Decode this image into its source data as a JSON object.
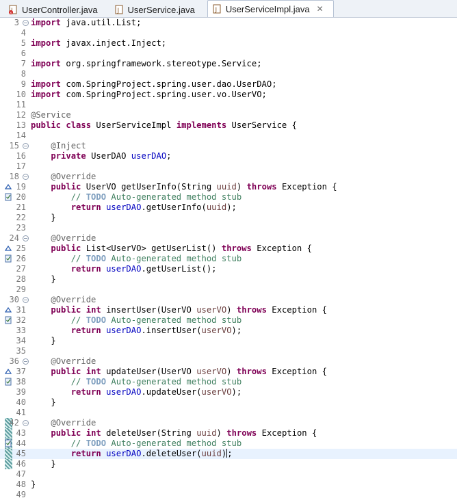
{
  "tabs": [
    {
      "label": "UserController.java",
      "active": false
    },
    {
      "label": "UserService.java",
      "active": false
    },
    {
      "label": "UserServiceImpl.java",
      "active": true
    }
  ],
  "colors": {
    "keyword": "#7f0055",
    "annotation": "#646464",
    "field": "#0000c0",
    "parameter": "#6a3e3e",
    "comment": "#3f7f5f",
    "todo": "#7f9fbf",
    "current_line": "#e8f2fe"
  },
  "lines": [
    {
      "n": "3",
      "fold": true,
      "t": [
        [
          "kw",
          "import"
        ],
        [
          "",
          "java.util.List;"
        ]
      ]
    },
    {
      "n": "4",
      "t": []
    },
    {
      "n": "5",
      "t": [
        [
          "kw",
          "import"
        ],
        [
          "",
          "javax.inject.Inject;"
        ]
      ]
    },
    {
      "n": "6",
      "t": []
    },
    {
      "n": "7",
      "t": [
        [
          "kw",
          "import"
        ],
        [
          "",
          "org.springframework.stereotype.Service;"
        ]
      ]
    },
    {
      "n": "8",
      "t": []
    },
    {
      "n": "9",
      "t": [
        [
          "kw",
          "import"
        ],
        [
          "",
          "com.SpringProject.spring.user.dao.UserDAO;"
        ]
      ]
    },
    {
      "n": "10",
      "t": [
        [
          "kw",
          "import"
        ],
        [
          "",
          "com.SpringProject.spring.user.vo.UserVO;"
        ]
      ]
    },
    {
      "n": "11",
      "t": []
    },
    {
      "n": "12",
      "t": [
        [
          "ann",
          "@Service"
        ]
      ]
    },
    {
      "n": "13",
      "t": [
        [
          "kw",
          "public"
        ],
        [
          "kw",
          "class"
        ],
        [
          "",
          "UserServiceImpl"
        ],
        [
          "kw",
          "implements"
        ],
        [
          "",
          "UserService {"
        ]
      ]
    },
    {
      "n": "14",
      "t": []
    },
    {
      "n": "15",
      "fold": true,
      "t": [
        [
          "",
          "    "
        ],
        [
          "ann",
          "@Inject"
        ]
      ]
    },
    {
      "n": "16",
      "t": [
        [
          "",
          "    "
        ],
        [
          "kw",
          "private"
        ],
        [
          "",
          "UserDAO"
        ],
        [
          "fld",
          "userDAO"
        ],
        [
          "",
          ";"
        ]
      ]
    },
    {
      "n": "17",
      "t": []
    },
    {
      "n": "18",
      "fold": true,
      "t": [
        [
          "",
          "    "
        ],
        [
          "ann",
          "@Override"
        ]
      ]
    },
    {
      "n": "19",
      "ov": true,
      "t": [
        [
          "",
          "    "
        ],
        [
          "kw",
          "public"
        ],
        [
          "",
          "UserVO getUserInfo(String"
        ],
        [
          "prm",
          "uuid"
        ],
        [
          "",
          ")"
        ],
        [
          "kw",
          "throws"
        ],
        [
          "",
          "Exception {"
        ]
      ]
    },
    {
      "n": "20",
      "todoicon": true,
      "t": [
        [
          "",
          "        "
        ],
        [
          "cmt",
          "// "
        ],
        [
          "todo",
          "TODO"
        ],
        [
          "cmt",
          "Auto-generated method stub"
        ]
      ]
    },
    {
      "n": "21",
      "t": [
        [
          "",
          "        "
        ],
        [
          "kw",
          "return"
        ],
        [
          "fld",
          "userDAO"
        ],
        [
          "",
          ".getUserInfo("
        ],
        [
          "prm",
          "uuid"
        ],
        [
          "",
          ");"
        ]
      ]
    },
    {
      "n": "22",
      "t": [
        [
          "",
          "    }"
        ]
      ]
    },
    {
      "n": "23",
      "t": []
    },
    {
      "n": "24",
      "fold": true,
      "t": [
        [
          "",
          "    "
        ],
        [
          "ann",
          "@Override"
        ]
      ]
    },
    {
      "n": "25",
      "ov": true,
      "t": [
        [
          "",
          "    "
        ],
        [
          "kw",
          "public"
        ],
        [
          "",
          "List<UserVO> getUserList()"
        ],
        [
          "kw",
          "throws"
        ],
        [
          "",
          "Exception {"
        ]
      ]
    },
    {
      "n": "26",
      "todoicon": true,
      "t": [
        [
          "",
          "        "
        ],
        [
          "cmt",
          "// "
        ],
        [
          "todo",
          "TODO"
        ],
        [
          "cmt",
          "Auto-generated method stub"
        ]
      ]
    },
    {
      "n": "27",
      "t": [
        [
          "",
          "        "
        ],
        [
          "kw",
          "return"
        ],
        [
          "fld",
          "userDAO"
        ],
        [
          "",
          ".getUserList();"
        ]
      ]
    },
    {
      "n": "28",
      "t": [
        [
          "",
          "    }"
        ]
      ]
    },
    {
      "n": "29",
      "t": []
    },
    {
      "n": "30",
      "fold": true,
      "t": [
        [
          "",
          "    "
        ],
        [
          "ann",
          "@Override"
        ]
      ]
    },
    {
      "n": "31",
      "ov": true,
      "t": [
        [
          "",
          "    "
        ],
        [
          "kw",
          "public"
        ],
        [
          "kw",
          "int"
        ],
        [
          "",
          "insertUser(UserVO"
        ],
        [
          "prm",
          "userVO"
        ],
        [
          "",
          ")"
        ],
        [
          "kw",
          "throws"
        ],
        [
          "",
          "Exception {"
        ]
      ]
    },
    {
      "n": "32",
      "todoicon": true,
      "t": [
        [
          "",
          "        "
        ],
        [
          "cmt",
          "// "
        ],
        [
          "todo",
          "TODO"
        ],
        [
          "cmt",
          "Auto-generated method stub"
        ]
      ]
    },
    {
      "n": "33",
      "t": [
        [
          "",
          "        "
        ],
        [
          "kw",
          "return"
        ],
        [
          "fld",
          "userDAO"
        ],
        [
          "",
          ".insertUser("
        ],
        [
          "prm",
          "userVO"
        ],
        [
          "",
          ");"
        ]
      ]
    },
    {
      "n": "34",
      "t": [
        [
          "",
          "    }"
        ]
      ]
    },
    {
      "n": "35",
      "t": []
    },
    {
      "n": "36",
      "fold": true,
      "t": [
        [
          "",
          "    "
        ],
        [
          "ann",
          "@Override"
        ]
      ]
    },
    {
      "n": "37",
      "ov": true,
      "t": [
        [
          "",
          "    "
        ],
        [
          "kw",
          "public"
        ],
        [
          "kw",
          "int"
        ],
        [
          "",
          "updateUser(UserVO"
        ],
        [
          "prm",
          "userVO"
        ],
        [
          "",
          ")"
        ],
        [
          "kw",
          "throws"
        ],
        [
          "",
          "Exception {"
        ]
      ]
    },
    {
      "n": "38",
      "todoicon": true,
      "t": [
        [
          "",
          "        "
        ],
        [
          "cmt",
          "// "
        ],
        [
          "todo",
          "TODO"
        ],
        [
          "cmt",
          "Auto-generated method stub"
        ]
      ]
    },
    {
      "n": "39",
      "t": [
        [
          "",
          "        "
        ],
        [
          "kw",
          "return"
        ],
        [
          "fld",
          "userDAO"
        ],
        [
          "",
          ".updateUser("
        ],
        [
          "prm",
          "userVO"
        ],
        [
          "",
          ");"
        ]
      ]
    },
    {
      "n": "40",
      "t": [
        [
          "",
          "    }"
        ]
      ]
    },
    {
      "n": "41",
      "t": []
    },
    {
      "n": "42",
      "fold": true,
      "marker": true,
      "t": [
        [
          "",
          "    "
        ],
        [
          "ann",
          "@Override"
        ]
      ]
    },
    {
      "n": "43",
      "marker": true,
      "t": [
        [
          "",
          "    "
        ],
        [
          "kw",
          "public"
        ],
        [
          "kw",
          "int"
        ],
        [
          "",
          "deleteUser(String"
        ],
        [
          "prm",
          "uuid"
        ],
        [
          "",
          ")"
        ],
        [
          "kw",
          "throws"
        ],
        [
          "",
          "Exception {"
        ]
      ]
    },
    {
      "n": "44",
      "marker": true,
      "todoicon": true,
      "t": [
        [
          "",
          "        "
        ],
        [
          "cmt",
          "// "
        ],
        [
          "todo",
          "TODO"
        ],
        [
          "cmt",
          "Auto-generated method stub"
        ]
      ]
    },
    {
      "n": "45",
      "marker": true,
      "current": true,
      "t": [
        [
          "",
          "        "
        ],
        [
          "kw",
          "return"
        ],
        [
          "fld",
          "userDAO"
        ],
        [
          "",
          ".deleteUser("
        ],
        [
          "prm",
          "uuid"
        ],
        [
          "",
          ")"
        ],
        [
          "caret",
          ""
        ],
        [
          "",
          ";"
        ]
      ]
    },
    {
      "n": "46",
      "marker": true,
      "t": [
        [
          "",
          "    }"
        ]
      ]
    },
    {
      "n": "47",
      "t": []
    },
    {
      "n": "48",
      "t": [
        [
          "",
          "}"
        ]
      ]
    },
    {
      "n": "49",
      "t": []
    }
  ]
}
